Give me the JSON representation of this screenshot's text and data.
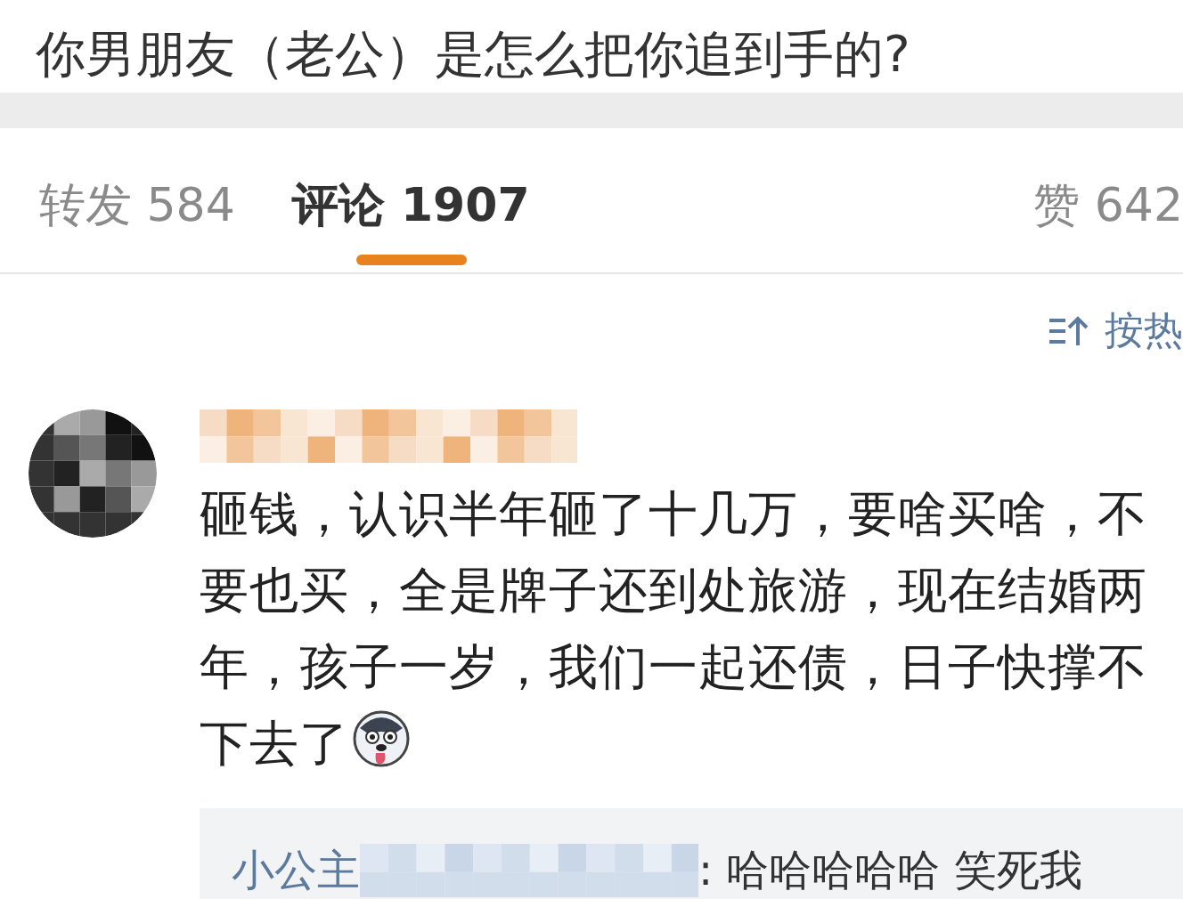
{
  "post": {
    "title": "你男朋友（老公）是怎么把你追到手的?"
  },
  "tabs": [
    {
      "label": "转发 584",
      "selected": false
    },
    {
      "label": "评论 1907",
      "selected": true
    },
    {
      "label": "赞 642",
      "selected": false
    }
  ],
  "sort": {
    "label": "按热"
  },
  "comment": {
    "text": "砸钱，认识半年砸了十几万，要啥买啥，不要也买，全是牌子还到处旅游，现在结婚两年，孩子一岁，我们一起还债，日子快撑不下去了",
    "reply": {
      "author": "小公主",
      "text": ": 哈哈哈哈哈 笑死我"
    }
  }
}
